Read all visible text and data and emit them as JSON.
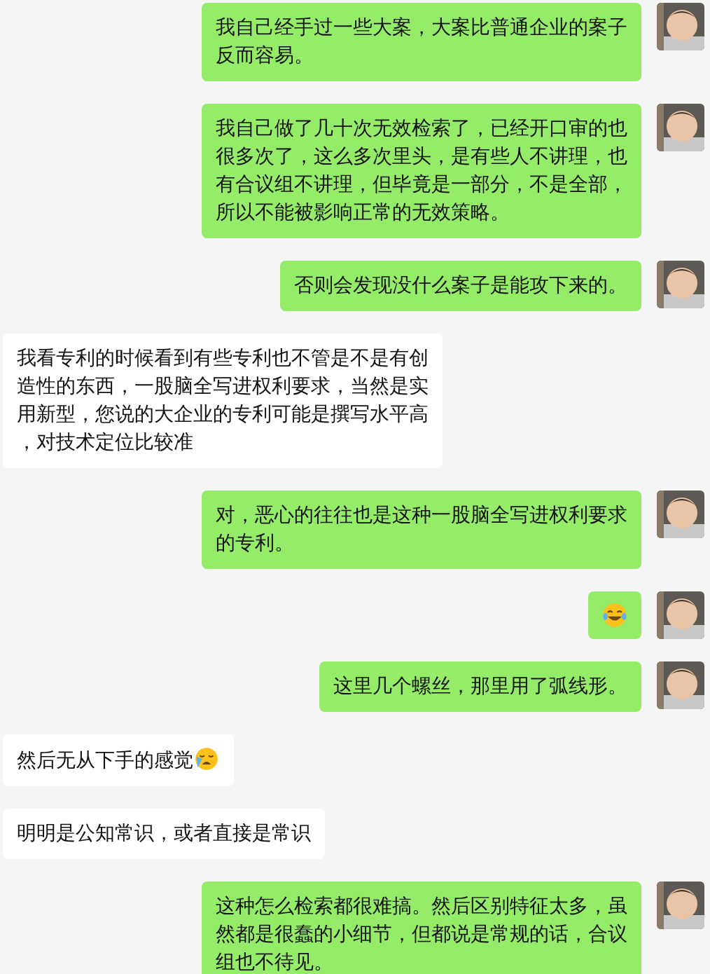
{
  "messages": [
    {
      "kind": "sent",
      "text": "我自己经手过一些大案，大案比普通企业的案子反而容易。"
    },
    {
      "kind": "sent",
      "text": "我自己做了几十次无效检索了，已经开口审的也很多次了，这么多次里头，是有些人不讲理，也有合议组不讲理，但毕竟是一部分，不是全部，所以不能被影响正常的无效策略。"
    },
    {
      "kind": "sent",
      "text": "否则会发现没什么案子是能攻下来的。"
    },
    {
      "kind": "received",
      "text": "我看专利的时候看到有些专利也不管是不是有创造性的东西，一股脑全写进权利要求，当然是实用新型，您说的大企业的专利可能是撰写水平高，对技术定位比较准"
    },
    {
      "kind": "sent",
      "text": "对，恶心的往往也是这种一股脑全写进权利要求的专利。"
    },
    {
      "kind": "sticker",
      "icon": {
        "kind": "laughing"
      }
    },
    {
      "kind": "sent",
      "text": "这里几个螺丝，那里用了弧线形。"
    },
    {
      "kind": "received",
      "text": "然后无从下手的感觉",
      "icon": {
        "kind": "crying"
      }
    },
    {
      "kind": "received",
      "text": "明明是公知常识，或者直接是常识"
    },
    {
      "kind": "sent",
      "text": "这种怎么检索都很难搞。然后区别特征太多，虽然都是很蠢的小细节，但都说是常规的话，合议组也不待见。"
    }
  ]
}
